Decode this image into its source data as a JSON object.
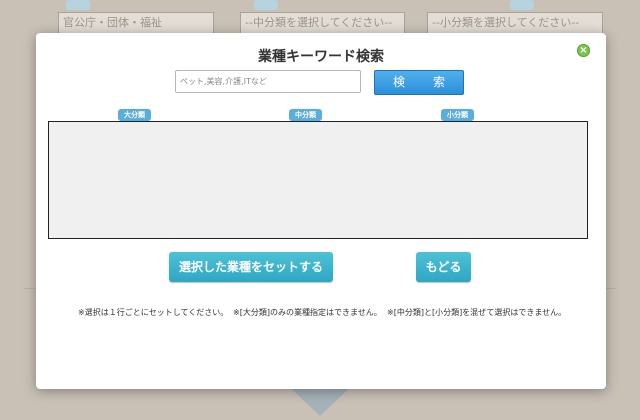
{
  "background": {
    "major_select": [
      "官公庁・団体・福祉"
    ],
    "middle_select_placeholder": "--中分類を選択してください--",
    "minor_select_placeholder": "--小分類を選択してください--"
  },
  "modal": {
    "title": "業種キーワード検索",
    "keyword_placeholder": "ペット,美容,介護,ITなど",
    "search_label": "検　索",
    "close_label": "×",
    "column_labels": {
      "major": "大分類",
      "middle": "中分類",
      "minor": "小分類"
    },
    "set_label": "選択した業種をセットする",
    "back_label": "もどる",
    "notes": [
      "※選択は１行ごとにセットしてください。",
      "※[大分類]のみの業種指定はできません。",
      "※[中分類]と[小分類]を混ぜて選択はできません。"
    ]
  },
  "colors": {
    "accent_blue": "#2d8fd9",
    "action_teal": "#2ea7c3",
    "close_green": "#7fc34d"
  }
}
